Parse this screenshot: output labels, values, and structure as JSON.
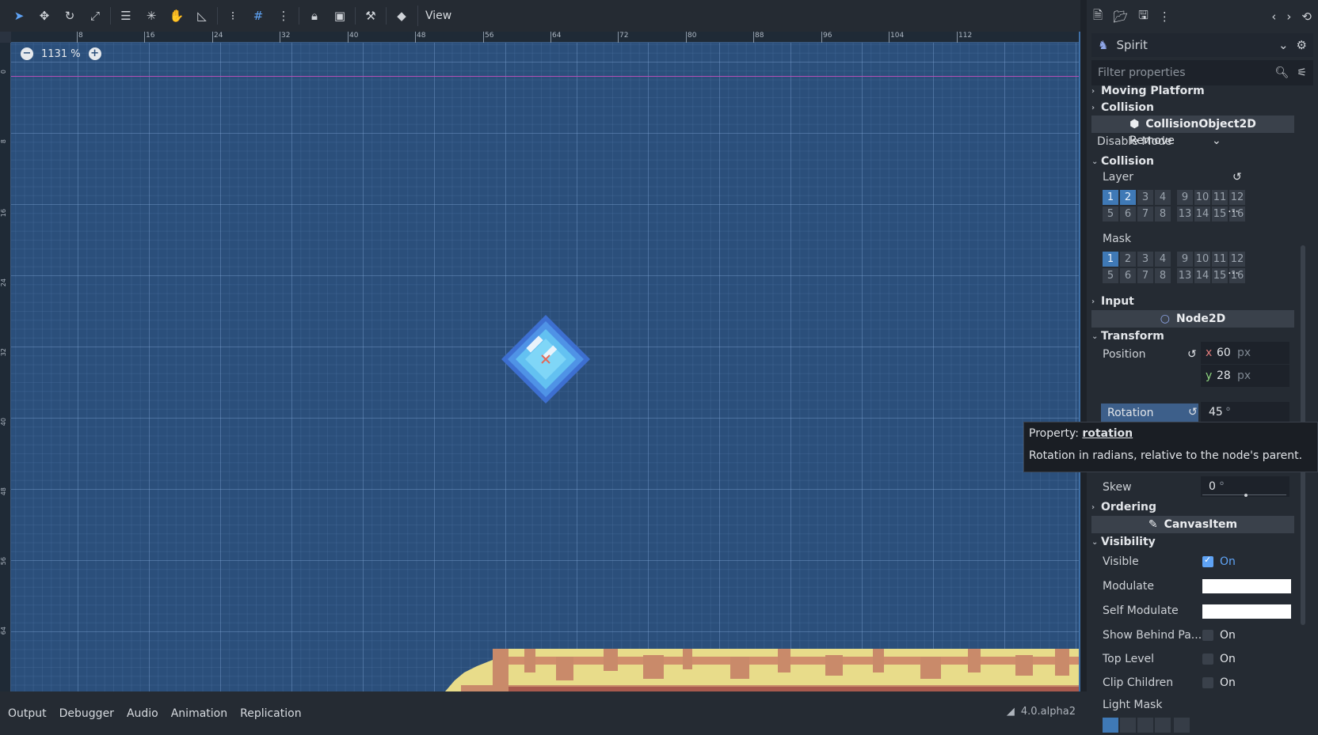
{
  "toolbar": {
    "view_label": "View"
  },
  "viewport": {
    "zoom": "1131 %",
    "ruler_top": [
      "8",
      "16",
      "24",
      "32",
      "40",
      "48",
      "56",
      "64",
      "72",
      "80",
      "88",
      "96",
      "104",
      "112"
    ],
    "ruler_left": [
      "0",
      "8",
      "16",
      "24",
      "32",
      "40",
      "48",
      "56",
      "64"
    ]
  },
  "bottom_panel": {
    "tabs": [
      "Output",
      "Debugger",
      "Audio",
      "Animation",
      "Replication"
    ],
    "version": "4.0.alpha2"
  },
  "inspector": {
    "node_name": "Spirit",
    "filter_placeholder": "Filter properties",
    "sections": {
      "moving_platform": "Moving Platform",
      "collision_top": "Collision",
      "collision_object": "CollisionObject2D",
      "disable_mode_label": "Disable Mode",
      "disable_mode_value": "Remove",
      "collision": "Collision",
      "layer": "Layer",
      "mask": "Mask",
      "input": "Input",
      "node2d": "Node2D",
      "transform": "Transform",
      "position": "Position",
      "pos_x_axis": "x",
      "pos_x": "60",
      "pos_y_axis": "y",
      "pos_y": "28",
      "px_unit": "px",
      "rotation": "Rotation",
      "rotation_value": "45",
      "degree": "°",
      "skew": "Skew",
      "skew_value": "0",
      "ordering": "Ordering",
      "canvas_item": "CanvasItem",
      "visibility": "Visibility",
      "visible": "Visible",
      "on": "On",
      "modulate": "Modulate",
      "self_modulate": "Self Modulate",
      "show_behind": "Show Behind Pa...",
      "top_level": "Top Level",
      "clip_children": "Clip Children",
      "light_mask": "Light Mask"
    },
    "layer_bits": {
      "row1": [
        "1",
        "2",
        "3",
        "4",
        "9",
        "10",
        "11",
        "12"
      ],
      "row2": [
        "5",
        "6",
        "7",
        "8",
        "13",
        "14",
        "15",
        "16"
      ],
      "on": [
        "1",
        "2"
      ]
    },
    "mask_bits": {
      "row1": [
        "1",
        "2",
        "3",
        "4",
        "9",
        "10",
        "11",
        "12"
      ],
      "row2": [
        "5",
        "6",
        "7",
        "8",
        "13",
        "14",
        "15",
        "16"
      ],
      "on": [
        "1"
      ]
    },
    "visibility_states": {
      "visible": true,
      "show_behind": false,
      "top_level": false,
      "clip_children": false
    },
    "modulate_color": "#ffffff",
    "self_modulate_color": "#ffffff"
  },
  "tooltip": {
    "prefix": "Property:",
    "name": "rotation",
    "description": "Rotation in radians, relative to the node's parent."
  },
  "colors": {
    "viewport_bg": "#2b4f7b",
    "accent": "#5fa3f5",
    "ground_yellow": "#e8dc8a",
    "ground_brown": "#c98a6a"
  }
}
